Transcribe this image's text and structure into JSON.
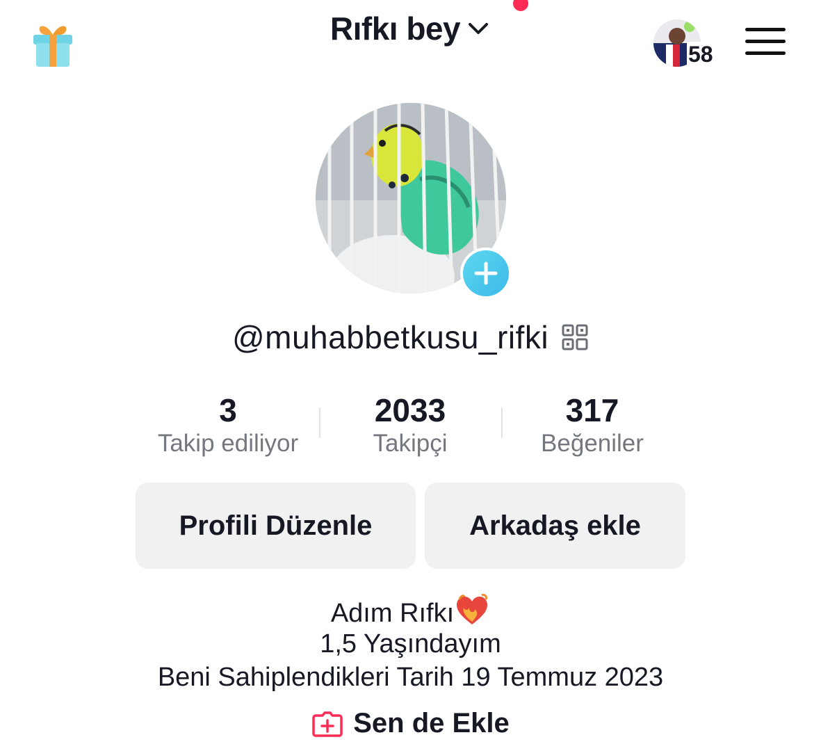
{
  "header": {
    "title": "Rıfkı bey",
    "friend_count": "58"
  },
  "profile": {
    "username": "@muhabbetkusu_rifki"
  },
  "stats": [
    {
      "value": "3",
      "label": "Takip ediliyor"
    },
    {
      "value": "2033",
      "label": "Takipçi"
    },
    {
      "value": "317",
      "label": "Beğeniler"
    }
  ],
  "actions": {
    "edit_profile": "Profili Düzenle",
    "add_friend": "Arkadaş ekle"
  },
  "bio": {
    "line1": "Adım Rıfkı",
    "line2": "1,5 Yaşındayım",
    "line3": "Beni Sahiplendikleri Tarih 19 Temmuz 2023"
  },
  "add_link": "Sen de Ekle",
  "colors": {
    "accent": "#fe2c55",
    "add_button": "#45c3ec",
    "button_bg": "#f1f1f2",
    "label_gray": "#75777e"
  },
  "icons": {
    "gift": "gift-icon",
    "chevron": "chevron-down-icon",
    "menu": "hamburger-menu-icon",
    "qr": "qr-code-icon",
    "add_photo": "plus-icon",
    "heart": "burning-heart-icon",
    "add_link": "add-box-icon"
  }
}
